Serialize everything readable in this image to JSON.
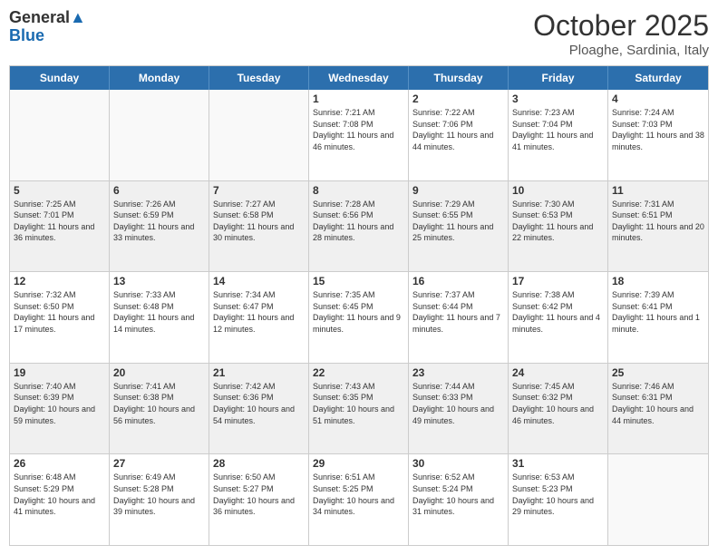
{
  "logo": {
    "general": "General",
    "blue": "Blue"
  },
  "header": {
    "month": "October 2025",
    "location": "Ploaghe, Sardinia, Italy"
  },
  "weekdays": [
    "Sunday",
    "Monday",
    "Tuesday",
    "Wednesday",
    "Thursday",
    "Friday",
    "Saturday"
  ],
  "rows": [
    [
      {
        "day": "",
        "info": "",
        "empty": true
      },
      {
        "day": "",
        "info": "",
        "empty": true
      },
      {
        "day": "",
        "info": "",
        "empty": true
      },
      {
        "day": "1",
        "info": "Sunrise: 7:21 AM\nSunset: 7:08 PM\nDaylight: 11 hours and 46 minutes."
      },
      {
        "day": "2",
        "info": "Sunrise: 7:22 AM\nSunset: 7:06 PM\nDaylight: 11 hours and 44 minutes."
      },
      {
        "day": "3",
        "info": "Sunrise: 7:23 AM\nSunset: 7:04 PM\nDaylight: 11 hours and 41 minutes."
      },
      {
        "day": "4",
        "info": "Sunrise: 7:24 AM\nSunset: 7:03 PM\nDaylight: 11 hours and 38 minutes."
      }
    ],
    [
      {
        "day": "5",
        "info": "Sunrise: 7:25 AM\nSunset: 7:01 PM\nDaylight: 11 hours and 36 minutes."
      },
      {
        "day": "6",
        "info": "Sunrise: 7:26 AM\nSunset: 6:59 PM\nDaylight: 11 hours and 33 minutes."
      },
      {
        "day": "7",
        "info": "Sunrise: 7:27 AM\nSunset: 6:58 PM\nDaylight: 11 hours and 30 minutes."
      },
      {
        "day": "8",
        "info": "Sunrise: 7:28 AM\nSunset: 6:56 PM\nDaylight: 11 hours and 28 minutes."
      },
      {
        "day": "9",
        "info": "Sunrise: 7:29 AM\nSunset: 6:55 PM\nDaylight: 11 hours and 25 minutes."
      },
      {
        "day": "10",
        "info": "Sunrise: 7:30 AM\nSunset: 6:53 PM\nDaylight: 11 hours and 22 minutes."
      },
      {
        "day": "11",
        "info": "Sunrise: 7:31 AM\nSunset: 6:51 PM\nDaylight: 11 hours and 20 minutes."
      }
    ],
    [
      {
        "day": "12",
        "info": "Sunrise: 7:32 AM\nSunset: 6:50 PM\nDaylight: 11 hours and 17 minutes."
      },
      {
        "day": "13",
        "info": "Sunrise: 7:33 AM\nSunset: 6:48 PM\nDaylight: 11 hours and 14 minutes."
      },
      {
        "day": "14",
        "info": "Sunrise: 7:34 AM\nSunset: 6:47 PM\nDaylight: 11 hours and 12 minutes."
      },
      {
        "day": "15",
        "info": "Sunrise: 7:35 AM\nSunset: 6:45 PM\nDaylight: 11 hours and 9 minutes."
      },
      {
        "day": "16",
        "info": "Sunrise: 7:37 AM\nSunset: 6:44 PM\nDaylight: 11 hours and 7 minutes."
      },
      {
        "day": "17",
        "info": "Sunrise: 7:38 AM\nSunset: 6:42 PM\nDaylight: 11 hours and 4 minutes."
      },
      {
        "day": "18",
        "info": "Sunrise: 7:39 AM\nSunset: 6:41 PM\nDaylight: 11 hours and 1 minute."
      }
    ],
    [
      {
        "day": "19",
        "info": "Sunrise: 7:40 AM\nSunset: 6:39 PM\nDaylight: 10 hours and 59 minutes."
      },
      {
        "day": "20",
        "info": "Sunrise: 7:41 AM\nSunset: 6:38 PM\nDaylight: 10 hours and 56 minutes."
      },
      {
        "day": "21",
        "info": "Sunrise: 7:42 AM\nSunset: 6:36 PM\nDaylight: 10 hours and 54 minutes."
      },
      {
        "day": "22",
        "info": "Sunrise: 7:43 AM\nSunset: 6:35 PM\nDaylight: 10 hours and 51 minutes."
      },
      {
        "day": "23",
        "info": "Sunrise: 7:44 AM\nSunset: 6:33 PM\nDaylight: 10 hours and 49 minutes."
      },
      {
        "day": "24",
        "info": "Sunrise: 7:45 AM\nSunset: 6:32 PM\nDaylight: 10 hours and 46 minutes."
      },
      {
        "day": "25",
        "info": "Sunrise: 7:46 AM\nSunset: 6:31 PM\nDaylight: 10 hours and 44 minutes."
      }
    ],
    [
      {
        "day": "26",
        "info": "Sunrise: 6:48 AM\nSunset: 5:29 PM\nDaylight: 10 hours and 41 minutes."
      },
      {
        "day": "27",
        "info": "Sunrise: 6:49 AM\nSunset: 5:28 PM\nDaylight: 10 hours and 39 minutes."
      },
      {
        "day": "28",
        "info": "Sunrise: 6:50 AM\nSunset: 5:27 PM\nDaylight: 10 hours and 36 minutes."
      },
      {
        "day": "29",
        "info": "Sunrise: 6:51 AM\nSunset: 5:25 PM\nDaylight: 10 hours and 34 minutes."
      },
      {
        "day": "30",
        "info": "Sunrise: 6:52 AM\nSunset: 5:24 PM\nDaylight: 10 hours and 31 minutes."
      },
      {
        "day": "31",
        "info": "Sunrise: 6:53 AM\nSunset: 5:23 PM\nDaylight: 10 hours and 29 minutes."
      },
      {
        "day": "",
        "info": "",
        "empty": true
      }
    ]
  ]
}
